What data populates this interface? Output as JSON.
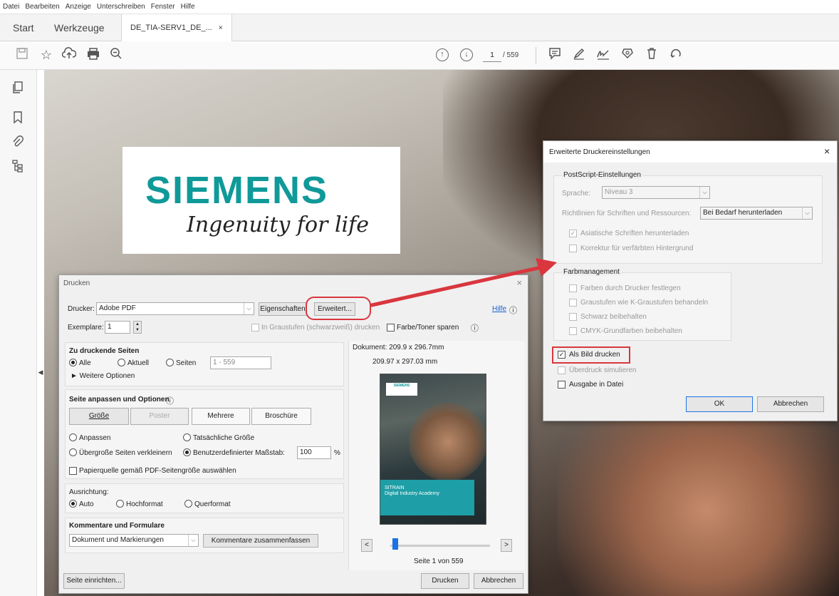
{
  "menu": [
    "Datei",
    "Bearbeiten",
    "Anzeige",
    "Unterschreiben",
    "Fenster",
    "Hilfe"
  ],
  "tabs": {
    "start": "Start",
    "tools": "Werkzeuge",
    "doc": "DE_TIA-SERV1_DE_...",
    "doc_close": "×"
  },
  "toolbar": {
    "page_current": "1",
    "page_total": "/ 559"
  },
  "document": {
    "brand": "SIEMENS",
    "tagline": "Ingenuity for life"
  },
  "print_dialog": {
    "title": "Drucken",
    "printer_label": "Drucker:",
    "printer_value": "Adobe PDF",
    "properties_btn": "Eigenschaften",
    "advanced_btn": "Erweitert...",
    "help_link": "Hilfe",
    "copies_label": "Exemplare:",
    "copies_value": "1",
    "grayscale_label": "In Graustufen (schwarzweiß) drucken",
    "toner_label": "Farbe/Toner sparen",
    "pages_heading": "Zu druckende Seiten",
    "radio_all": "Alle",
    "radio_current": "Aktuell",
    "radio_pages": "Seiten",
    "pages_range": "1 - 559",
    "more_options": "► Weitere Optionen",
    "fit_heading": "Seite anpassen und Optionen",
    "btn_size": "Größe",
    "btn_poster": "Poster",
    "btn_multiple": "Mehrere",
    "btn_booklet": "Broschüre",
    "radio_fit": "Anpassen",
    "radio_actual": "Tatsächliche Größe",
    "radio_shrink": "Übergroße Seiten verkleinern",
    "radio_custom": "Benutzerdefinierter Maßstab:",
    "scale_value": "100",
    "scale_unit": "%",
    "paper_source": "Papierquelle gemäß PDF-Seitengröße auswählen",
    "orientation_heading": "Ausrichtung:",
    "radio_auto": "Auto",
    "radio_portrait": "Hochformat",
    "radio_landscape": "Querformat",
    "comments_heading": "Kommentare und Formulare",
    "comments_value": "Dokument und Markierungen",
    "summarize_btn": "Kommentare zusammenfassen",
    "doc_size": "Dokument: 209.9 x 296.7mm",
    "paper_size": "209.97 x 297.03 mm",
    "preview_logo": "SIEMENS",
    "preview_teal_text": "SITRAIN\nDigital Industry Academy",
    "nav_prev": "<",
    "nav_next": ">",
    "page_of": "Seite 1 von 559",
    "page_setup_btn": "Seite einrichten...",
    "print_btn": "Drucken",
    "cancel_btn": "Abbrechen"
  },
  "adv_dialog": {
    "title": "Erweiterte Druckereinstellungen",
    "close": "×",
    "ps_heading": "PostScript-Einstellungen",
    "lang_label": "Sprache:",
    "lang_value": "Niveau 3",
    "font_policy_label": "Richtlinien für Schriften und Ressourcen:",
    "font_policy_value": "Bei Bedarf herunterladen",
    "asian_fonts": "Asiatische Schriften herunterladen",
    "bg_correction": "Korrektur für verfärbten Hintergrund",
    "color_heading": "Farbmanagement",
    "color_opt1": "Farben durch Drucker festlegen",
    "color_opt2": "Graustufen wie K-Graustufen behandeln",
    "color_opt3": "Schwarz beibehalten",
    "color_opt4": "CMYK-Grundfarben beibehalten",
    "print_as_image": "Als Bild drucken",
    "simulate_overprint": "Überdruck simulieren",
    "output_to_file": "Ausgabe in Datei",
    "ok_btn": "OK",
    "cancel_btn": "Abbrechen"
  },
  "colors": {
    "accent": "#d9363e",
    "brand_teal": "#109999",
    "slider": "#1a73e8"
  }
}
